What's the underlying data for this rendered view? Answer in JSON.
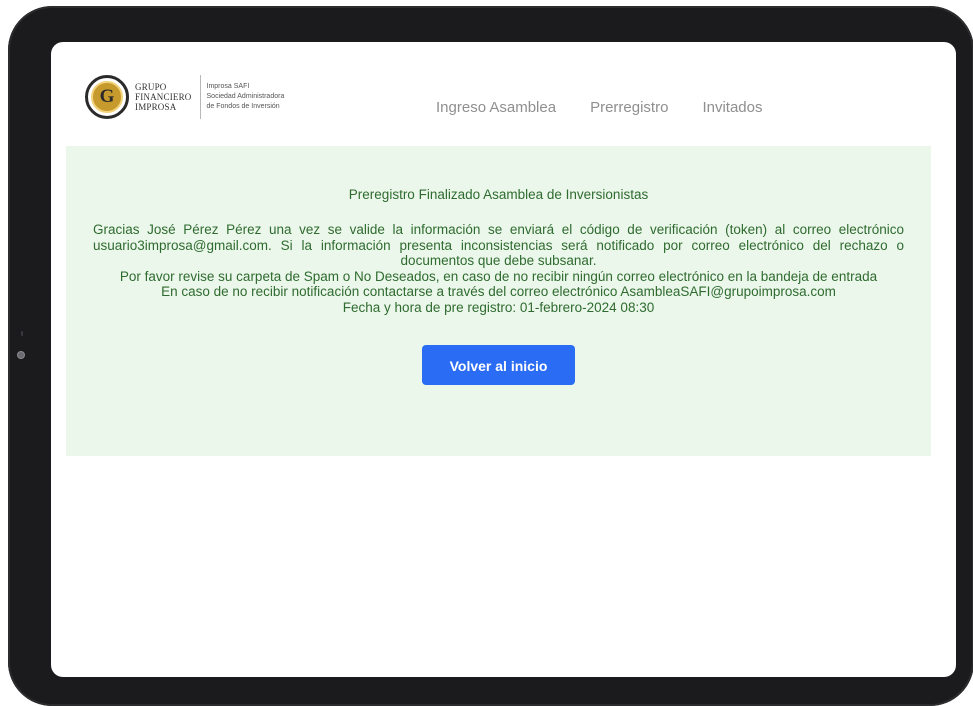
{
  "logo": {
    "brand_line1": "GRUPO",
    "brand_line2": "FINANCIERO",
    "brand_line3": "IMPROSA",
    "sub_line1": "Improsa SAFI",
    "sub_line2": "Sociedad Administradora",
    "sub_line3": "de Fondos de Inversión",
    "emblem_glyph": "G",
    "emblem_color": "#c79a2d"
  },
  "nav": {
    "items": [
      {
        "label": "Ingreso Asamblea"
      },
      {
        "label": "Prerregistro"
      },
      {
        "label": "Invitados"
      }
    ]
  },
  "message": {
    "title": "Preregistro Finalizado Asamblea de Inversionistas",
    "paragraph": "Gracias José Pérez Pérez una vez se valide la información se enviará el código de verificación (token) al correo electrónico usuario3improsa@gmail.com. Si la información presenta inconsistencias será notificado por correo electrónico del rechazo o documentos que debe subsanar.",
    "spam_notice": "Por favor revise su carpeta de Spam o No Deseados, en caso de no recibir ningún correo electrónico en la bandeja de entrada",
    "contact_notice": "En caso de no recibir notificación contactarse a través del correo electrónico AsambleaSAFI@grupoimprosa.com",
    "timestamp": "Fecha y hora de pre registro: 01-febrero-2024 08:30"
  },
  "actions": {
    "back_label": "Volver al inicio"
  },
  "colors": {
    "panel_bg": "#ebf7ea",
    "panel_text": "#2f6b30",
    "button_bg": "#2a6df4",
    "nav_text": "#8f8f8f",
    "device_frame": "#1b1b1d"
  }
}
